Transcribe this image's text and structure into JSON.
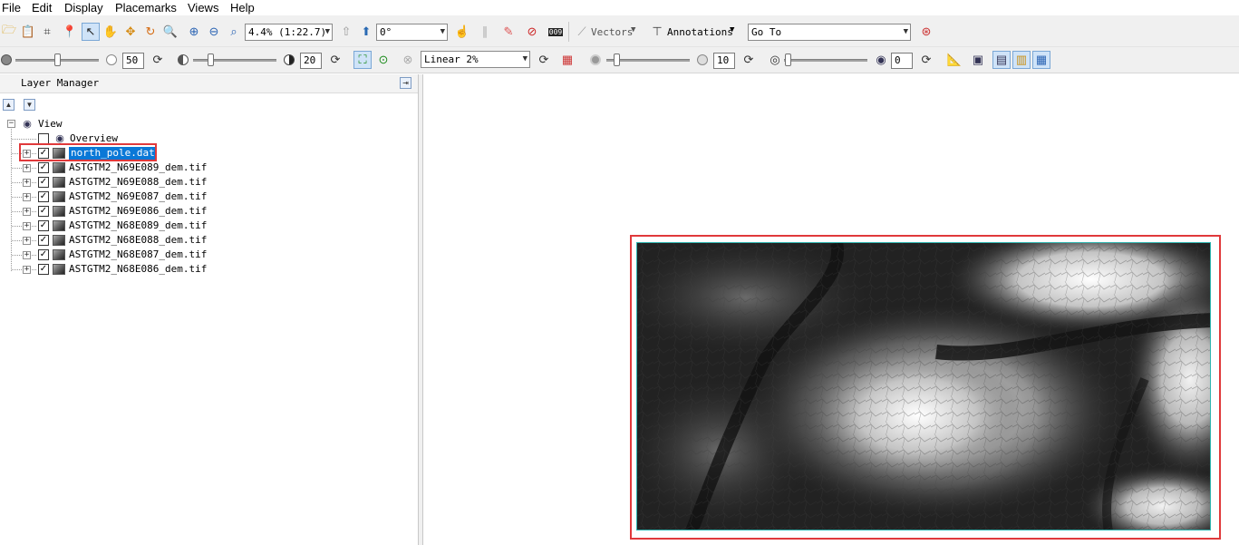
{
  "menu": [
    "File",
    "Edit",
    "Display",
    "Placemarks",
    "Views",
    "Help"
  ],
  "toolbar1": {
    "zoom_value": "4.4% (1:22.7)",
    "rotation_value": "0°",
    "vectors_label": "Vectors",
    "annotations_label": "Annotations",
    "goto_value": "Go To"
  },
  "toolbar2": {
    "brightness_value": "50",
    "contrast_value": "20",
    "stretch_value": "Linear 2%",
    "sharpen_value": "10",
    "transparency_value": "0"
  },
  "layer_manager": {
    "title": "Layer Manager",
    "root_label": "View",
    "overview_label": "Overview",
    "layers": [
      {
        "name": "north_pole.dat",
        "checked": true,
        "selected": true
      },
      {
        "name": "ASTGTM2_N69E089_dem.tif",
        "checked": true,
        "selected": false
      },
      {
        "name": "ASTGTM2_N69E088_dem.tif",
        "checked": true,
        "selected": false
      },
      {
        "name": "ASTGTM2_N69E087_dem.tif",
        "checked": true,
        "selected": false
      },
      {
        "name": "ASTGTM2_N69E086_dem.tif",
        "checked": true,
        "selected": false
      },
      {
        "name": "ASTGTM2_N68E089_dem.tif",
        "checked": true,
        "selected": false
      },
      {
        "name": "ASTGTM2_N68E088_dem.tif",
        "checked": true,
        "selected": false
      },
      {
        "name": "ASTGTM2_N68E087_dem.tif",
        "checked": true,
        "selected": false
      },
      {
        "name": "ASTGTM2_N68E086_dem.tif",
        "checked": true,
        "selected": false
      }
    ]
  },
  "colors": {
    "highlight": "#e0393b",
    "selection": "#0a78d7",
    "image_border": "#2fb5b0"
  }
}
